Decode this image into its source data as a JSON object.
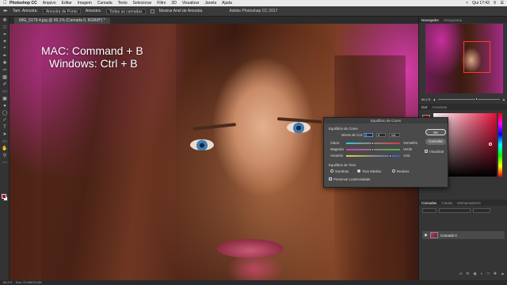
{
  "menubar": {
    "app": "Photoshop CC",
    "items": [
      "Arquivo",
      "Editar",
      "Imagem",
      "Camada",
      "Texto",
      "Selecionar",
      "Filtro",
      "3D",
      "Visualizar",
      "Janela",
      "Ajuda"
    ],
    "clock": "Qui 17:43"
  },
  "options_bar": {
    "document_title": "Adobe Photoshop CC 2017",
    "amostra_label": "Tam. Amostra:",
    "amostra_value": "Amostra de Ponto",
    "amostra2_label": "Amostra:",
    "amostra2_value": "Todas as camadas",
    "show_ring_label": "Mostrar Anel de Amostra"
  },
  "tab": {
    "label": "IMG_5179-4.jpg @ 66,1% (Camada 0, RGB/8*) *"
  },
  "canvas": {
    "overlay_line1": "MAC: Command + B",
    "overlay_line2": "Windows: Ctrl + B"
  },
  "status": {
    "zoom": "66,1%",
    "doc": "Doc: 23,4M/23,4M"
  },
  "navigator": {
    "tab_active": "Navegador",
    "tab_other": "Histograma",
    "zoom": "66,1%"
  },
  "color_panel": {
    "tab_active": "Cor",
    "tab_other": "Amostras"
  },
  "layers_panel": {
    "tabs": [
      "Camadas",
      "Canais",
      "Demarcadores"
    ],
    "layer_name": "Camada 0"
  },
  "dialog": {
    "title": "Equilíbrio de Cores",
    "section_color": "Equilíbrio de Cores",
    "levels_label": "Níveis de Cor:",
    "levels": [
      "0",
      "0",
      "+61"
    ],
    "sliders": [
      {
        "left": "Ciano",
        "right": "Vermelho",
        "value": 0.5
      },
      {
        "left": "Magenta",
        "right": "Verde",
        "value": 0.5
      },
      {
        "left": "Amarelo",
        "right": "Azul",
        "value": 0.8
      }
    ],
    "section_tone": "Equilíbrio de Tons",
    "tones": [
      "Sombras",
      "Tons Médios",
      "Realces"
    ],
    "selected_tone": "Tons Médios",
    "preserve_label": "Preservar Luminosidade",
    "ok_label": "OK",
    "cancel_label": "Cancelar",
    "preview_label": "Visualizar"
  }
}
